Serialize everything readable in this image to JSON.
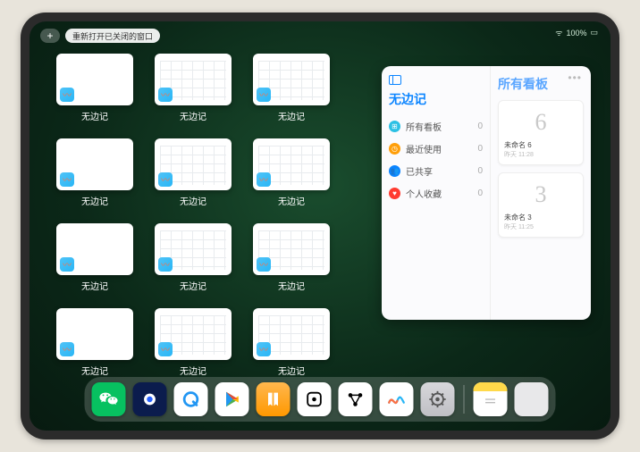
{
  "status": {
    "time_label": "100%"
  },
  "topbar": {
    "plus": "+",
    "reopen_label": "重新打开已关闭的窗口"
  },
  "app_label": "无边记",
  "thumbs": [
    {
      "variant": "blank"
    },
    {
      "variant": "calendar"
    },
    {
      "variant": "calendar"
    },
    {
      "variant": "blank"
    },
    {
      "variant": "calendar"
    },
    {
      "variant": "calendar"
    },
    {
      "variant": "blank"
    },
    {
      "variant": "calendar"
    },
    {
      "variant": "calendar"
    },
    {
      "variant": "blank"
    },
    {
      "variant": "calendar"
    },
    {
      "variant": "calendar"
    }
  ],
  "panel": {
    "left_title": "无边记",
    "right_title": "所有看板",
    "categories": [
      {
        "label": "所有看板",
        "count": "0",
        "color": "#2bc0e4",
        "glyph": "⊞"
      },
      {
        "label": "最近使用",
        "count": "0",
        "color": "#ff9f0a",
        "glyph": "◷"
      },
      {
        "label": "已共享",
        "count": "0",
        "color": "#0a84ff",
        "glyph": "👥"
      },
      {
        "label": "个人收藏",
        "count": "0",
        "color": "#ff3b30",
        "glyph": "♥"
      }
    ],
    "boards": [
      {
        "sketch": "6",
        "title": "未命名 6",
        "sub": "昨天 11:28"
      },
      {
        "sketch": "3",
        "title": "未命名 3",
        "sub": "昨天 11:25"
      }
    ]
  },
  "dock": [
    {
      "name": "wechat",
      "kind": "wechat"
    },
    {
      "name": "quark",
      "kind": "navy"
    },
    {
      "name": "qqbrowser",
      "kind": "white-q"
    },
    {
      "name": "play",
      "kind": "white-play"
    },
    {
      "name": "books",
      "kind": "orange"
    },
    {
      "name": "dice",
      "kind": "white-dice"
    },
    {
      "name": "connect",
      "kind": "white-graph"
    },
    {
      "name": "freeform",
      "kind": "white-freeform"
    },
    {
      "name": "settings",
      "kind": "gray"
    },
    {
      "name": "notes",
      "kind": "notes"
    },
    {
      "name": "app-library",
      "kind": "folder"
    }
  ]
}
